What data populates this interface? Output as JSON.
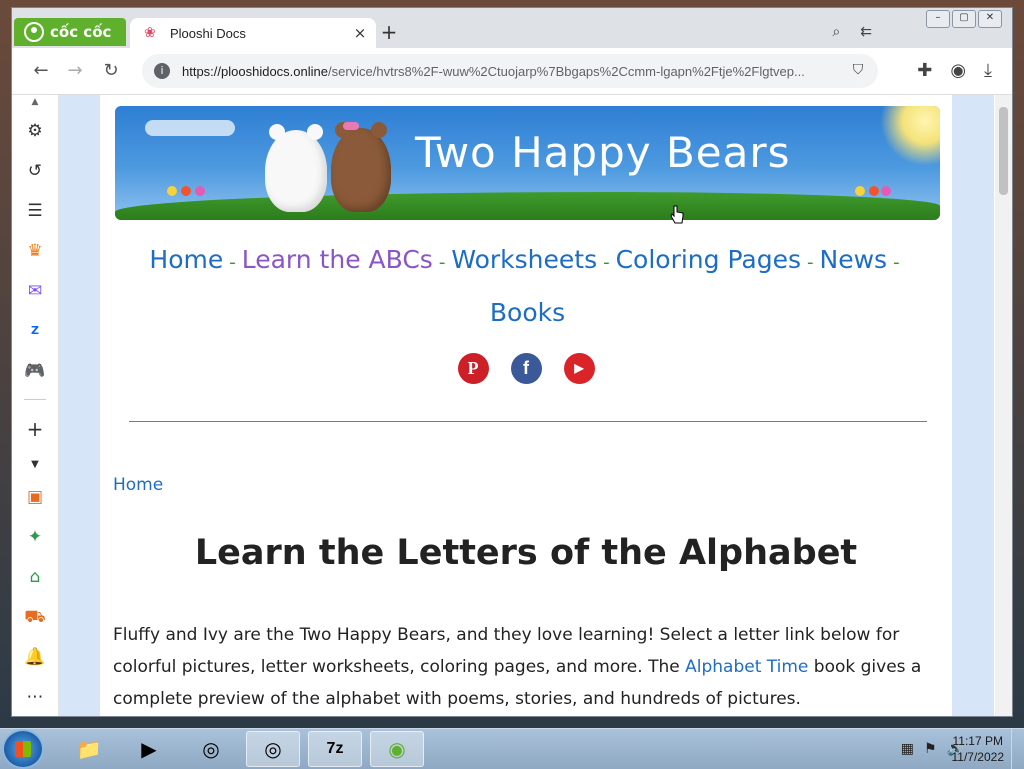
{
  "browser": {
    "brand": "cốc cốc",
    "tab_title": "Plooshi Docs",
    "tab_close": "×",
    "new_tab": "+",
    "url_host": "https://plooshidocs.online",
    "url_path": "/service/hvtrs8%2F-wuw%2Ctuojarp%7Bbgaps%2Ccmm-lgapn%2Ftje%2Flgtvep...",
    "url_prefix_icon": "i"
  },
  "site": {
    "banner_title": "Two Happy Bears",
    "nav": {
      "items": [
        "Home",
        "Learn the ABCs",
        "Worksheets",
        "Coloring Pages",
        "News",
        "Books"
      ],
      "separator": "-"
    },
    "social": {
      "pinterest": "P",
      "facebook": "f",
      "youtube": "▶"
    },
    "breadcrumb": "Home",
    "heading": "Learn the Letters of the Alphabet",
    "intro_part1": "Fluffy and Ivy are the Two Happy Bears, and they love learning! Select a letter link below for colorful pictures, letter worksheets, coloring pages, and more. The ",
    "intro_link": "Alphabet Time",
    "intro_part2": " book gives a complete preview of the alphabet with poems, stories, and hundreds of pictures."
  },
  "taskbar": {
    "time": "11:17 PM",
    "date": "11/7/2022",
    "sevenzip_label": "7z"
  },
  "colors": {
    "link": "#1d6dc5",
    "link_visited": "#8a55c7",
    "separator": "#2a9d2a",
    "coccoc_green": "#5fb12d"
  }
}
